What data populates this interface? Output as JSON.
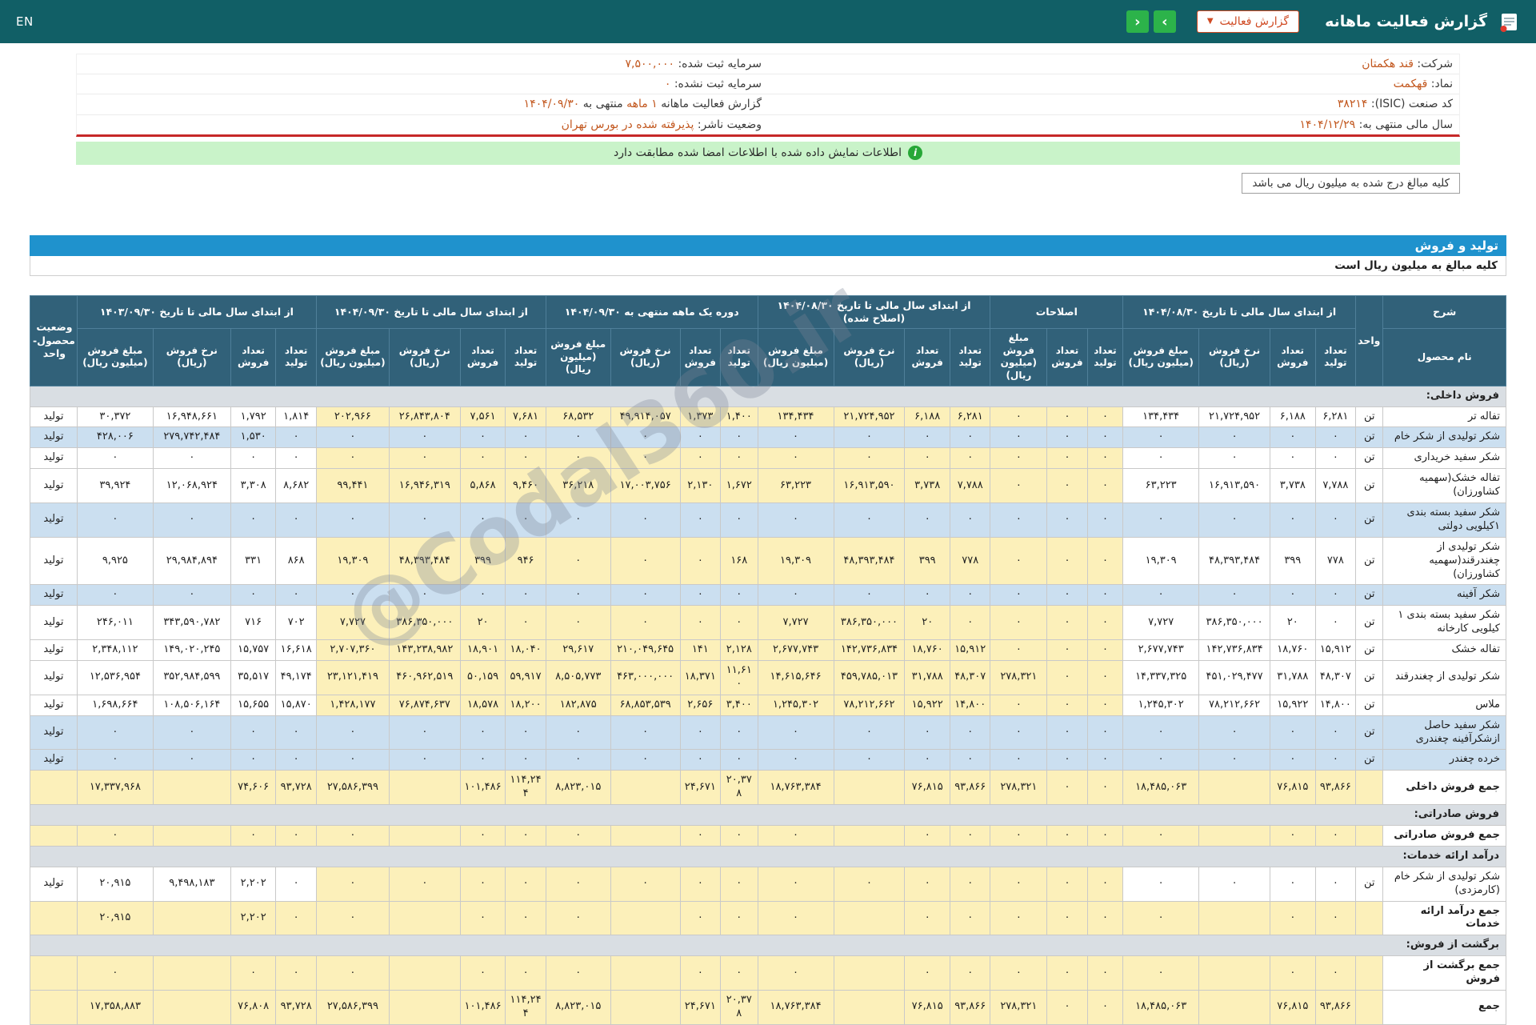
{
  "header": {
    "title": "گزارش فعالیت ماهانه",
    "report_select": "گزارش فعالیت",
    "nav_right": "›",
    "nav_left": "‹",
    "lang": "EN"
  },
  "info": {
    "company_label": "شرکت:",
    "company": "قند هکمتان",
    "symbol_label": "نماد:",
    "symbol": "قهکمت",
    "isic_label": "کد صنعت (ISIC):",
    "isic": "۳۸۲۱۴",
    "fiscal_year_label": "سال مالی منتهی به:",
    "fiscal_year": "۱۴۰۴/۱۲/۲۹",
    "registered_capital_label": "سرمایه ثبت شده:",
    "registered_capital": "۷,۵۰۰,۰۰۰",
    "unregistered_capital_label": "سرمایه ثبت نشده:",
    "unregistered_capital": "۰",
    "report_period_label": "گزارش فعالیت ماهانه",
    "report_period": "۱ ماهه",
    "report_period_label2": "منتهی به",
    "report_period_end": "۱۴۰۴/۰۹/۳۰",
    "listing_status_label": "وضعیت ناشر:",
    "listing_status": "پذیرفته شده در بورس تهران"
  },
  "banner": {
    "text": "اطلاعات نمایش داده شده با اطلاعات امضا شده مطابقت دارد"
  },
  "notes": {
    "million_rial_note": "کلیه مبالغ درج شده به میلیون ریال می باشد"
  },
  "watermark": {
    "text": "@Codal360.ir"
  },
  "table": {
    "section_title": "تولید و فروش",
    "note": "کلیه مبالغ به میلیون ریال است",
    "header": {
      "desc": "شرح",
      "product": "نام محصول",
      "unit": "واحد",
      "status": "وضعیت محصول-واحد",
      "groups": [
        {
          "title": "از ابتدای سال مالی تا تاریخ ۱۴۰۴/۰۸/۳۰",
          "cols": [
            "تعداد تولید",
            "تعداد فروش",
            "نرخ فروش (ریال)",
            "مبلغ فروش (میلیون ریال)"
          ]
        },
        {
          "title": "اصلاحات",
          "cols": [
            "تعداد تولید",
            "تعداد فروش",
            "مبلغ فروش (میلیون ریال)"
          ]
        },
        {
          "title": "از ابتدای سال مالی تا تاریخ ۱۴۰۴/۰۸/۳۰ (اصلاح شده)",
          "cols": [
            "تعداد تولید",
            "تعداد فروش",
            "نرخ فروش (ریال)",
            "مبلغ فروش (میلیون ریال)"
          ]
        },
        {
          "title": "دوره یک ماهه منتهی به ۱۴۰۴/۰۹/۳۰",
          "cols": [
            "تعداد تولید",
            "تعداد فروش",
            "نرخ فروش (ریال)",
            "مبلغ فروش (میلیون ریال)"
          ]
        },
        {
          "title": "از ابتدای سال مالی تا تاریخ ۱۴۰۴/۰۹/۳۰",
          "cols": [
            "تعداد تولید",
            "تعداد فروش",
            "نرخ فروش (ریال)",
            "مبلغ فروش (میلیون ریال)"
          ]
        },
        {
          "title": "از ابتدای سال مالی تا تاریخ ۱۴۰۳/۰۹/۳۰",
          "cols": [
            "تعداد تولید",
            "تعداد فروش",
            "نرخ فروش (ریال)",
            "مبلغ فروش (میلیون ریال)"
          ]
        }
      ]
    },
    "rows": [
      {
        "type": "section",
        "name": "فروش داخلی:"
      },
      {
        "type": "product",
        "name": "تفاله تر",
        "unit": "تن",
        "status": "تولید",
        "stripe": false,
        "g1": [
          "۳۰,۳۷۲",
          "۱۶,۹۴۸,۶۶۱",
          "۱,۷۹۲",
          "۱,۸۱۴"
        ],
        "g2": [
          "۲۰۲,۹۶۶",
          "۲۶,۸۴۳,۸۰۴",
          "۷,۵۶۱",
          "۷,۶۸۱"
        ],
        "g3": [
          "۶۸,۵۳۲",
          "۴۹,۹۱۴,۰۵۷",
          "۱,۳۷۳",
          "۱,۴۰۰"
        ],
        "g4": [
          "۱۳۴,۴۳۴",
          "۲۱,۷۲۴,۹۵۲",
          "۶,۱۸۸",
          "۶,۲۸۱"
        ],
        "adj": [
          "۰",
          "۰",
          "۰"
        ],
        "g6": [
          "۱۳۴,۴۳۴",
          "۲۱,۷۲۴,۹۵۲",
          "۶,۱۸۸",
          "۶,۲۸۱"
        ]
      },
      {
        "type": "product",
        "name": "شکر تولیدی از شکر خام",
        "unit": "تن",
        "status": "تولید",
        "stripe": true,
        "g1": [
          "۴۲۸,۰۰۶",
          "۲۷۹,۷۴۲,۴۸۴",
          "۱,۵۳۰",
          "۰"
        ],
        "g2": [
          "۰",
          "۰",
          "۰",
          "۰"
        ],
        "g3": [
          "۰",
          "۰",
          "۰",
          "۰"
        ],
        "g4": [
          "۰",
          "۰",
          "۰",
          "۰"
        ],
        "adj": [
          "۰",
          "۰",
          "۰"
        ],
        "g6": [
          "۰",
          "۰",
          "۰",
          "۰"
        ]
      },
      {
        "type": "product",
        "name": "شکر سفید خریداری",
        "unit": "تن",
        "status": "تولید",
        "stripe": false,
        "g1": [
          "۰",
          "۰",
          "۰",
          "۰"
        ],
        "g2": [
          "۰",
          "۰",
          "۰",
          "۰"
        ],
        "g3": [
          "۰",
          "۰",
          "۰",
          "۰"
        ],
        "g4": [
          "۰",
          "۰",
          "۰",
          "۰"
        ],
        "adj": [
          "۰",
          "۰",
          "۰"
        ],
        "g6": [
          "۰",
          "۰",
          "۰",
          "۰"
        ]
      },
      {
        "type": "product",
        "name": "تفاله خشک(سهمیه کشاورزان)",
        "unit": "تن",
        "status": "تولید",
        "stripe": false,
        "g1": [
          "۳۹,۹۲۴",
          "۱۲,۰۶۸,۹۲۴",
          "۳,۳۰۸",
          "۸,۶۸۲"
        ],
        "g2": [
          "۹۹,۴۴۱",
          "۱۶,۹۴۶,۳۱۹",
          "۵,۸۶۸",
          "۹,۴۶۰"
        ],
        "g3": [
          "۳۶,۲۱۸",
          "۱۷,۰۰۳,۷۵۶",
          "۲,۱۳۰",
          "۱,۶۷۲"
        ],
        "g4": [
          "۶۳,۲۲۳",
          "۱۶,۹۱۳,۵۹۰",
          "۳,۷۳۸",
          "۷,۷۸۸"
        ],
        "adj": [
          "۰",
          "۰",
          "۰"
        ],
        "g6": [
          "۶۳,۲۲۳",
          "۱۶,۹۱۳,۵۹۰",
          "۳,۷۳۸",
          "۷,۷۸۸"
        ]
      },
      {
        "type": "product",
        "name": "شکر سفید بسته بندی ۱کیلویی دولتی",
        "unit": "تن",
        "status": "تولید",
        "stripe": true,
        "g1": [
          "۰",
          "۰",
          "۰",
          "۰"
        ],
        "g2": [
          "۰",
          "۰",
          "۰",
          "۰"
        ],
        "g3": [
          "۰",
          "۰",
          "۰",
          "۰"
        ],
        "g4": [
          "۰",
          "۰",
          "۰",
          "۰"
        ],
        "adj": [
          "۰",
          "۰",
          "۰"
        ],
        "g6": [
          "۰",
          "۰",
          "۰",
          "۰"
        ]
      },
      {
        "type": "product",
        "name": "شکر تولیدی از چغندرقند(سهمیه کشاورزان)",
        "unit": "تن",
        "status": "تولید",
        "stripe": false,
        "g1": [
          "۹,۹۲۵",
          "۲۹,۹۸۴,۸۹۴",
          "۳۳۱",
          "۸۶۸"
        ],
        "g2": [
          "۱۹,۳۰۹",
          "۴۸,۳۹۳,۴۸۴",
          "۳۹۹",
          "۹۴۶"
        ],
        "g3": [
          "۰",
          "۰",
          "۰",
          "۱۶۸"
        ],
        "g4": [
          "۱۹,۳۰۹",
          "۴۸,۳۹۳,۴۸۴",
          "۳۹۹",
          "۷۷۸"
        ],
        "adj": [
          "۰",
          "۰",
          "۰"
        ],
        "g6": [
          "۱۹,۳۰۹",
          "۴۸,۳۹۳,۴۸۴",
          "۳۹۹",
          "۷۷۸"
        ]
      },
      {
        "type": "product",
        "name": "شکر آفینه",
        "unit": "تن",
        "status": "تولید",
        "stripe": true,
        "g1": [
          "۰",
          "۰",
          "۰",
          "۰"
        ],
        "g2": [
          "۰",
          "۰",
          "۰",
          "۰"
        ],
        "g3": [
          "۰",
          "۰",
          "۰",
          "۰"
        ],
        "g4": [
          "۰",
          "۰",
          "۰",
          "۰"
        ],
        "adj": [
          "۰",
          "۰",
          "۰"
        ],
        "g6": [
          "۰",
          "۰",
          "۰",
          "۰"
        ]
      },
      {
        "type": "product",
        "name": "شکر سفید بسته بندی ۱ کیلویی کارخانه",
        "unit": "تن",
        "status": "تولید",
        "stripe": false,
        "g1": [
          "۲۴۶,۰۱۱",
          "۳۴۳,۵۹۰,۷۸۲",
          "۷۱۶",
          "۷۰۲"
        ],
        "g2": [
          "۷,۷۲۷",
          "۳۸۶,۳۵۰,۰۰۰",
          "۲۰",
          "۰"
        ],
        "g3": [
          "۰",
          "۰",
          "۰",
          "۰"
        ],
        "g4": [
          "۷,۷۲۷",
          "۳۸۶,۳۵۰,۰۰۰",
          "۲۰",
          "۰"
        ],
        "adj": [
          "۰",
          "۰",
          "۰"
        ],
        "g6": [
          "۷,۷۲۷",
          "۳۸۶,۳۵۰,۰۰۰",
          "۲۰",
          "۰"
        ]
      },
      {
        "type": "product",
        "name": "تفاله خشک",
        "unit": "تن",
        "status": "تولید",
        "stripe": false,
        "g1": [
          "۲,۳۴۸,۱۱۲",
          "۱۴۹,۰۲۰,۲۴۵",
          "۱۵,۷۵۷",
          "۱۶,۶۱۸"
        ],
        "g2": [
          "۲,۷۰۷,۳۶۰",
          "۱۴۳,۲۳۸,۹۸۲",
          "۱۸,۹۰۱",
          "۱۸,۰۴۰"
        ],
        "g3": [
          "۲۹,۶۱۷",
          "۲۱۰,۰۴۹,۶۴۵",
          "۱۴۱",
          "۲,۱۲۸"
        ],
        "g4": [
          "۲,۶۷۷,۷۴۳",
          "۱۴۲,۷۳۶,۸۳۴",
          "۱۸,۷۶۰",
          "۱۵,۹۱۲"
        ],
        "adj": [
          "۰",
          "۰",
          "۰"
        ],
        "g6": [
          "۲,۶۷۷,۷۴۳",
          "۱۴۲,۷۳۶,۸۳۴",
          "۱۸,۷۶۰",
          "۱۵,۹۱۲"
        ]
      },
      {
        "type": "product",
        "name": "شکر تولیدی از چغندرقند",
        "unit": "تن",
        "status": "تولید",
        "stripe": false,
        "g1": [
          "۱۲,۵۳۶,۹۵۴",
          "۳۵۲,۹۸۴,۵۹۹",
          "۳۵,۵۱۷",
          "۴۹,۱۷۴"
        ],
        "g2": [
          "۲۳,۱۲۱,۴۱۹",
          "۴۶۰,۹۶۲,۵۱۹",
          "۵۰,۱۵۹",
          "۵۹,۹۱۷"
        ],
        "g3": [
          "۸,۵۰۵,۷۷۳",
          "۴۶۳,۰۰۰,۰۰۰",
          "۱۸,۳۷۱",
          "۱۱,۶۱۰"
        ],
        "g4": [
          "۱۴,۶۱۵,۶۴۶",
          "۴۵۹,۷۸۵,۰۱۳",
          "۳۱,۷۸۸",
          "۴۸,۳۰۷"
        ],
        "adj": [
          "۲۷۸,۳۲۱",
          "۰",
          "۰"
        ],
        "g6": [
          "۱۴,۳۳۷,۳۲۵",
          "۴۵۱,۰۲۹,۴۷۷",
          "۳۱,۷۸۸",
          "۴۸,۳۰۷"
        ]
      },
      {
        "type": "product",
        "name": "ملاس",
        "unit": "تن",
        "status": "تولید",
        "stripe": false,
        "g1": [
          "۱,۶۹۸,۶۶۴",
          "۱۰۸,۵۰۶,۱۶۴",
          "۱۵,۶۵۵",
          "۱۵,۸۷۰"
        ],
        "g2": [
          "۱,۴۲۸,۱۷۷",
          "۷۶,۸۷۴,۶۳۷",
          "۱۸,۵۷۸",
          "۱۸,۲۰۰"
        ],
        "g3": [
          "۱۸۲,۸۷۵",
          "۶۸,۸۵۳,۵۳۹",
          "۲,۶۵۶",
          "۳,۴۰۰"
        ],
        "g4": [
          "۱,۲۴۵,۳۰۲",
          "۷۸,۲۱۲,۶۶۲",
          "۱۵,۹۲۲",
          "۱۴,۸۰۰"
        ],
        "adj": [
          "۰",
          "۰",
          "۰"
        ],
        "g6": [
          "۱,۲۴۵,۳۰۲",
          "۷۸,۲۱۲,۶۶۲",
          "۱۵,۹۲۲",
          "۱۴,۸۰۰"
        ]
      },
      {
        "type": "product",
        "name": "شکر سفید حاصل ازشکرآفینه چغندری",
        "unit": "تن",
        "status": "تولید",
        "stripe": true,
        "g1": [
          "۰",
          "۰",
          "۰",
          "۰"
        ],
        "g2": [
          "۰",
          "۰",
          "۰",
          "۰"
        ],
        "g3": [
          "۰",
          "۰",
          "۰",
          "۰"
        ],
        "g4": [
          "۰",
          "۰",
          "۰",
          "۰"
        ],
        "adj": [
          "۰",
          "۰",
          "۰"
        ],
        "g6": [
          "۰",
          "۰",
          "۰",
          "۰"
        ]
      },
      {
        "type": "product",
        "name": "خرده چغندر",
        "unit": "تن",
        "status": "تولید",
        "stripe": true,
        "g1": [
          "۰",
          "۰",
          "۰",
          "۰"
        ],
        "g2": [
          "۰",
          "۰",
          "۰",
          "۰"
        ],
        "g3": [
          "۰",
          "۰",
          "۰",
          "۰"
        ],
        "g4": [
          "۰",
          "۰",
          "۰",
          "۰"
        ],
        "adj": [
          "۰",
          "۰",
          "۰"
        ],
        "g6": [
          "۰",
          "۰",
          "۰",
          "۰"
        ]
      },
      {
        "type": "total",
        "name": "جمع فروش داخلی",
        "unit": "",
        "status": "",
        "g1": [
          "۱۷,۳۳۷,۹۶۸",
          "",
          "۷۴,۶۰۶",
          "۹۳,۷۲۸"
        ],
        "g2": [
          "۲۷,۵۸۶,۳۹۹",
          "",
          "۱۰۱,۴۸۶",
          "۱۱۴,۲۴۴"
        ],
        "g3": [
          "۸,۸۲۳,۰۱۵",
          "",
          "۲۴,۶۷۱",
          "۲۰,۳۷۸"
        ],
        "g4": [
          "۱۸,۷۶۳,۳۸۴",
          "",
          "۷۶,۸۱۵",
          "۹۳,۸۶۶"
        ],
        "adj": [
          "۲۷۸,۳۲۱",
          "۰",
          "۰"
        ],
        "g6": [
          "۱۸,۴۸۵,۰۶۳",
          "",
          "۷۶,۸۱۵",
          "۹۳,۸۶۶"
        ]
      },
      {
        "type": "section",
        "name": "فروش صادراتی:"
      },
      {
        "type": "total",
        "name": "جمع فروش صادراتی",
        "unit": "",
        "status": "",
        "g1": [
          "۰",
          "",
          "۰",
          "۰"
        ],
        "g2": [
          "۰",
          "",
          "۰",
          "۰"
        ],
        "g3": [
          "۰",
          "",
          "۰",
          "۰"
        ],
        "g4": [
          "۰",
          "",
          "۰",
          "۰"
        ],
        "adj": [
          "۰",
          "۰",
          "۰"
        ],
        "g6": [
          "۰",
          "",
          "۰",
          "۰"
        ]
      },
      {
        "type": "section",
        "name": "درآمد ارائه خدمات:"
      },
      {
        "type": "product",
        "name": "شکر تولیدی از شکر خام (کارمزدی)",
        "unit": "تن",
        "status": "تولید",
        "stripe": false,
        "g1": [
          "۲۰,۹۱۵",
          "۹,۴۹۸,۱۸۳",
          "۲,۲۰۲",
          "۰"
        ],
        "g2": [
          "۰",
          "۰",
          "۰",
          "۰"
        ],
        "g3": [
          "۰",
          "۰",
          "۰",
          "۰"
        ],
        "g4": [
          "۰",
          "۰",
          "۰",
          "۰"
        ],
        "adj": [
          "۰",
          "۰",
          "۰"
        ],
        "g6": [
          "۰",
          "۰",
          "۰",
          "۰"
        ]
      },
      {
        "type": "total",
        "name": "جمع درآمد ارائه خدمات",
        "unit": "",
        "status": "",
        "g1": [
          "۲۰,۹۱۵",
          "",
          "۲,۲۰۲",
          "۰"
        ],
        "g2": [
          "۰",
          "",
          "۰",
          "۰"
        ],
        "g3": [
          "۰",
          "",
          "۰",
          "۰"
        ],
        "g4": [
          "۰",
          "",
          "۰",
          "۰"
        ],
        "adj": [
          "۰",
          "۰",
          "۰"
        ],
        "g6": [
          "۰",
          "",
          "۰",
          "۰"
        ]
      },
      {
        "type": "section",
        "name": "برگشت از فروش:"
      },
      {
        "type": "total",
        "name": "جمع برگشت از فروش",
        "unit": "",
        "status": "",
        "g1": [
          "۰",
          "",
          "۰",
          "۰"
        ],
        "g2": [
          "۰",
          "",
          "۰",
          "۰"
        ],
        "g3": [
          "۰",
          "",
          "۰",
          "۰"
        ],
        "g4": [
          "۰",
          "",
          "۰",
          "۰"
        ],
        "adj": [
          "۰",
          "۰",
          "۰"
        ],
        "g6": [
          "۰",
          "",
          "۰",
          "۰"
        ]
      },
      {
        "type": "total",
        "name": "جمع",
        "unit": "",
        "status": "",
        "g1": [
          "۱۷,۳۵۸,۸۸۳",
          "",
          "۷۶,۸۰۸",
          "۹۳,۷۲۸"
        ],
        "g2": [
          "۲۷,۵۸۶,۳۹۹",
          "",
          "۱۰۱,۴۸۶",
          "۱۱۴,۲۴۴"
        ],
        "g3": [
          "۸,۸۲۳,۰۱۵",
          "",
          "۲۴,۶۷۱",
          "۲۰,۳۷۸"
        ],
        "g4": [
          "۱۸,۷۶۳,۳۸۴",
          "",
          "۷۶,۸۱۵",
          "۹۳,۸۶۶"
        ],
        "adj": [
          "۲۷۸,۳۲۱",
          "۰",
          "۰"
        ],
        "g6": [
          "۱۸,۴۸۵,۰۶۳",
          "",
          "۷۶,۸۱۵",
          "۹۳,۸۶۶"
        ]
      }
    ]
  }
}
